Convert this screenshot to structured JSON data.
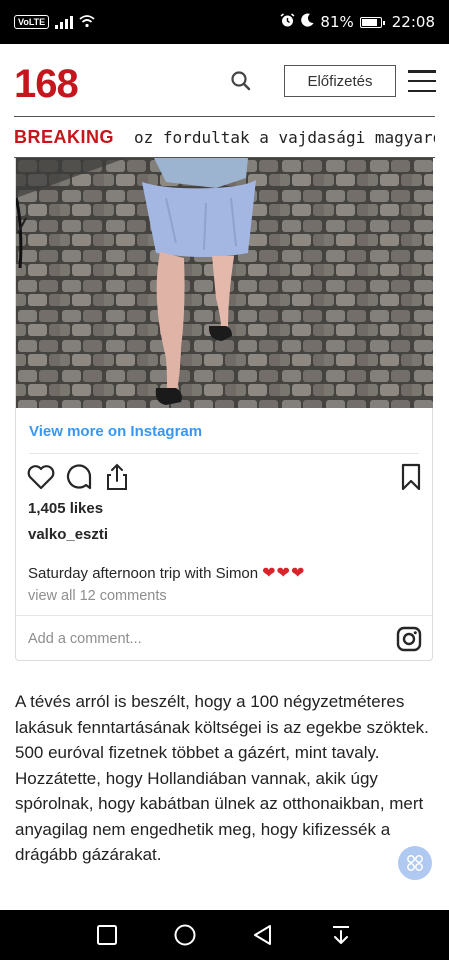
{
  "status_bar": {
    "volte": "VoLTE",
    "battery": "81%",
    "time": "22:08"
  },
  "header": {
    "logo": "168",
    "subscribe_label": "Előfizetés"
  },
  "breaking": {
    "label": "BREAKING",
    "ticker_text": "oz fordultak a vajdasági magyarok"
  },
  "instagram": {
    "view_more": "View more on Instagram",
    "likes": "1,405 likes",
    "username": "valko_eszti",
    "caption": "Saturday afternoon trip with Simon",
    "caption_emoji": "❤❤❤",
    "comments_link": "view all 12 comments",
    "add_comment_placeholder": "Add a comment..."
  },
  "article": {
    "paragraph": "A tévés arról is beszélt, hogy a 100 négyzetméteres lakásuk fenntartásának költségei is az egekbe szöktek. 500 euróval fizetnek többet a gázért, mint tavaly. Hozzátette, hogy Hollandiában vannak, akik úgy spórolnak, hogy kabátban ülnek az otthonaikban, mert anyagilag nem engedhetik meg, hogy kifizessék a drágább gázárakat."
  },
  "colors": {
    "brand_red": "#c4161c",
    "instagram_blue": "#3897f0",
    "muted_gray": "#8e8e8e"
  },
  "icons": {
    "status": [
      "alarm-icon",
      "moon-icon",
      "signal-icon",
      "wifi-icon",
      "battery-icon"
    ],
    "header": [
      "search-icon",
      "hamburger-menu-icon"
    ],
    "instagram": [
      "heart-icon",
      "comment-icon",
      "share-icon",
      "bookmark-icon",
      "instagram-logo-icon"
    ],
    "nav": [
      "square-recent-icon",
      "circle-home-icon",
      "triangle-back-icon",
      "download-arrow-icon"
    ]
  }
}
